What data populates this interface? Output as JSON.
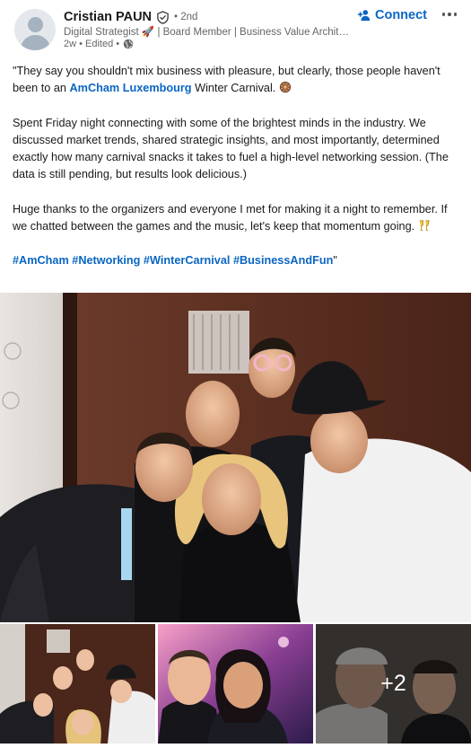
{
  "author": {
    "name": "Cristian PAUN",
    "degree": "• 2nd",
    "headline": "Digital Strategist 🚀 | Board Member | Business Value Archite...",
    "time": "2w • Edited •"
  },
  "actions": {
    "connect_label": "Connect"
  },
  "post": {
    "p1_a": "\"They say you shouldn't mix business with pleasure, but clearly, those people haven't been to an ",
    "p1_link": "AmCham Luxembourg",
    "p1_b": " Winter Carnival. ",
    "p2": "Spent Friday night connecting with some of the brightest minds in the industry. We discussed market trends, shared strategic insights, and most importantly, determined exactly how many carnival snacks it takes to fuel a high-level networking session. (The data is still pending, but results look delicious.)",
    "p3": "Huge thanks to the organizers and everyone I met for making it a night to remember. If we chatted between the games and the music, let's keep that momentum going. ",
    "hashtags": "#AmCham #Networking #WinterCarnival #BusinessAndFun",
    "closing_quote": "\""
  },
  "media": {
    "more_count": "+2"
  },
  "colors": {
    "link": "#0a66c2",
    "muted": "#666666"
  }
}
